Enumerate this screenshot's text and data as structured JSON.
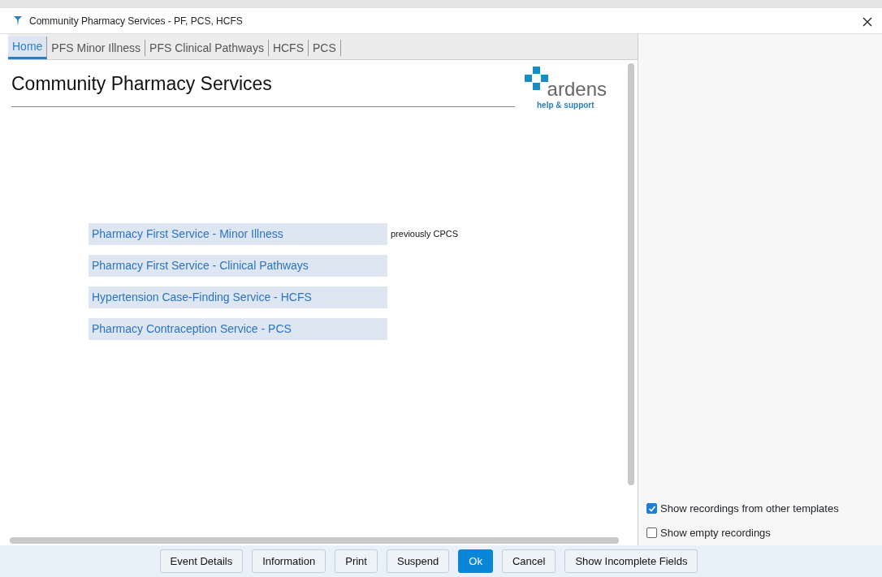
{
  "window": {
    "title": "Community Pharmacy Services - PF, PCS, HCFS"
  },
  "tabs": [
    {
      "label": "Home",
      "selected": true
    },
    {
      "label": "PFS Minor Illness",
      "selected": false
    },
    {
      "label": "PFS Clinical Pathways",
      "selected": false
    },
    {
      "label": "HCFS",
      "selected": false
    },
    {
      "label": "PCS",
      "selected": false
    }
  ],
  "page": {
    "heading": "Community Pharmacy Services",
    "logo": {
      "word": "ardens",
      "tagline": "help & support"
    },
    "links": [
      {
        "label": "Pharmacy First Service - Minor Illness",
        "note": "previously CPCS"
      },
      {
        "label": "Pharmacy First Service - Clinical Pathways"
      },
      {
        "label": "Hypertension Case-Finding Service - HCFS"
      },
      {
        "label": "Pharmacy Contraception Service - PCS"
      }
    ]
  },
  "options": [
    {
      "label": "Show recordings from other templates",
      "checked": true
    },
    {
      "label": "Show empty recordings",
      "checked": false
    }
  ],
  "buttons": [
    {
      "label": "Event Details",
      "primary": false
    },
    {
      "label": "Information",
      "primary": false
    },
    {
      "label": "Print",
      "primary": false
    },
    {
      "label": "Suspend",
      "primary": false
    },
    {
      "label": "Ok",
      "primary": true
    },
    {
      "label": "Cancel",
      "primary": false
    },
    {
      "label": "Show Incomplete Fields",
      "primary": false
    }
  ]
}
